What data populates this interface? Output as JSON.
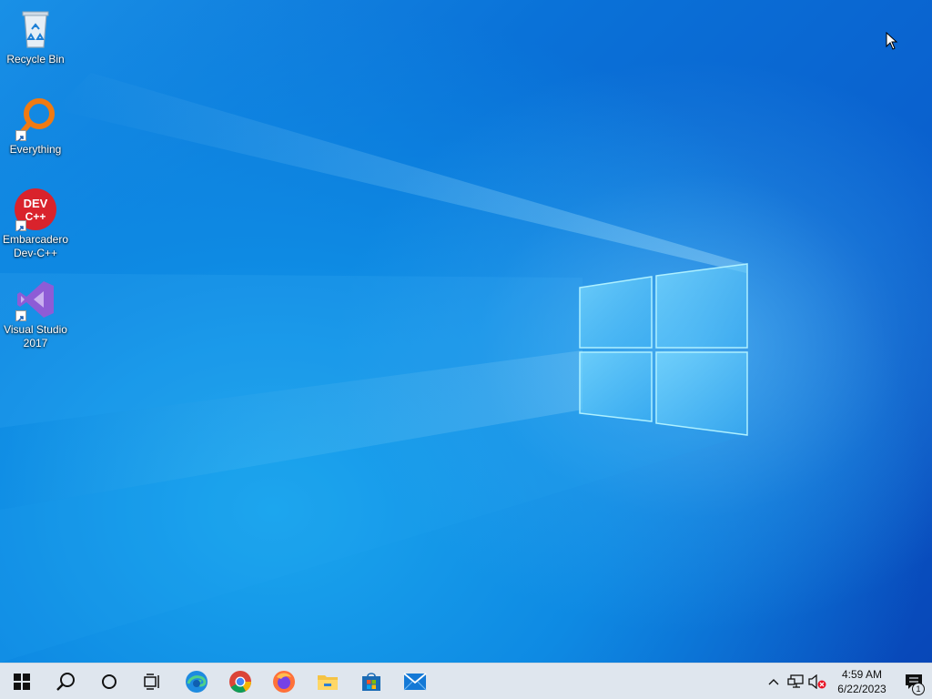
{
  "desktop": {
    "icons": [
      {
        "label": "Recycle Bin",
        "icon": "recycle-bin-icon"
      },
      {
        "label": "Everything",
        "icon": "everything-search-icon"
      },
      {
        "label": "Embarcadero Dev-C++",
        "icon": "devcpp-icon",
        "badge_text": "DEV C++"
      },
      {
        "label": "Visual Studio 2017",
        "icon": "visual-studio-icon"
      }
    ],
    "colors": {
      "wallpaper_top": "#0a72d8",
      "wallpaper_glow": "#78d2ff",
      "logo": "#8fe3ff"
    }
  },
  "taskbar": {
    "buttons": [
      {
        "name": "start-button",
        "icon": "windows-logo-icon"
      },
      {
        "name": "search-button",
        "icon": "search-icon"
      },
      {
        "name": "cortana-button",
        "icon": "cortana-circle-icon"
      },
      {
        "name": "task-view-button",
        "icon": "task-view-icon"
      },
      {
        "name": "edge-button",
        "icon": "edge-icon"
      },
      {
        "name": "chrome-button",
        "icon": "chrome-icon"
      },
      {
        "name": "firefox-button",
        "icon": "firefox-icon"
      },
      {
        "name": "file-explorer-button",
        "icon": "folder-icon"
      },
      {
        "name": "store-button",
        "icon": "store-icon"
      },
      {
        "name": "mail-button",
        "icon": "mail-icon"
      }
    ],
    "tray": {
      "overflow_icon": "chevron-up-icon",
      "network_icon": "network-icon",
      "volume_icon": "volume-muted-icon",
      "time": "4:59 AM",
      "date": "6/22/2023",
      "notification_count": "1"
    },
    "colors": {
      "background": "#dfe6ee"
    }
  }
}
